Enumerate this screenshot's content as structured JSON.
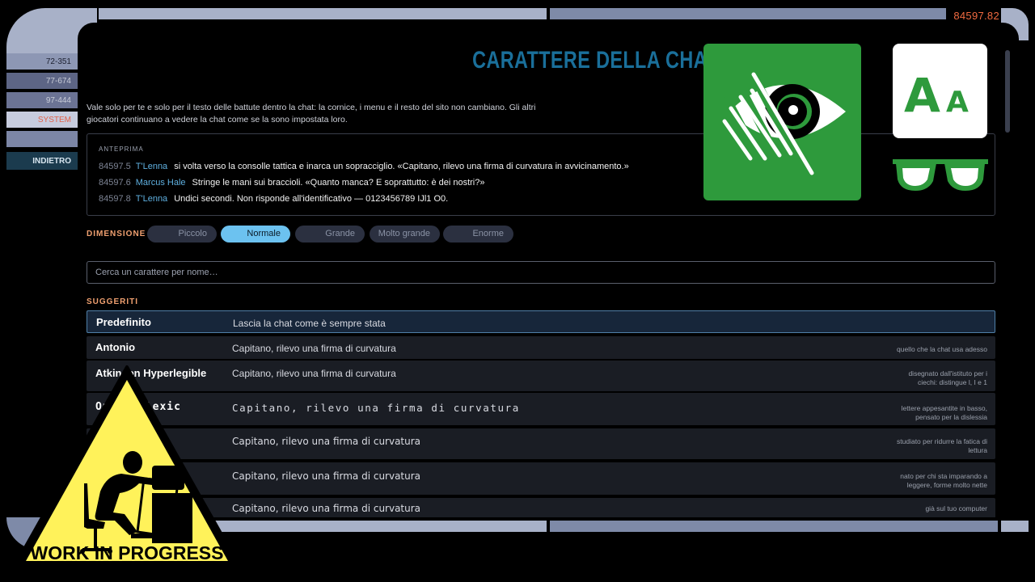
{
  "frame": {
    "stardate": "84597.82",
    "rail": [
      {
        "label": "72-351"
      },
      {
        "label": "77-674"
      },
      {
        "label": "97-444"
      },
      {
        "label": "SYSTEM"
      }
    ],
    "back_label": "INDIETRO"
  },
  "page": {
    "title": "CARATTERE DELLA CHAT",
    "description": "Vale solo per te e solo per il testo delle battute dentro la chat: la cornice, i menu e il resto del sito non cambiano. Gli altri giocatori continuano a vedere la chat come se la sono impostata loro."
  },
  "preview": {
    "label": "ANTEPRIMA",
    "lines": [
      {
        "stardate": "84597.5",
        "who": "T'Lenna",
        "msg": "si volta verso la consolle tattica e inarca un sopracciglio. «Capitano, rilevo una firma di curvatura in avvicinamento.»"
      },
      {
        "stardate": "84597.6",
        "who": "Marcus Hale",
        "msg": "Stringe le mani sui braccioli. «Quanto manca? E soprattutto: è dei nostri?»"
      },
      {
        "stardate": "84597.8",
        "who": "T'Lenna",
        "msg": "Undici secondi. Non risponde all'identificativo — 0123456789 IJl1 O0."
      }
    ]
  },
  "size": {
    "label": "DIMENSIONE",
    "options": [
      "Piccolo",
      "Normale",
      "Grande",
      "Molto grande",
      "Enorme"
    ],
    "selected": "Normale"
  },
  "search": {
    "placeholder": "Cerca un carattere per nome…"
  },
  "suggestions": {
    "label": "SUGGERITI",
    "items": [
      {
        "name": "Predefinito",
        "sample": "Lascia la chat come è sempre stata",
        "note": ""
      },
      {
        "name": "Antonio",
        "sample": "Capitano, rilevo una firma di curvatura",
        "note": "quello che la chat usa adesso"
      },
      {
        "name": "Atkinson Hyperlegible",
        "sample": "Capitano, rilevo una firma di curvatura",
        "note": "disegnato dall'istituto per i ciechi: distingue l, I e 1"
      },
      {
        "name": "OpenDyslexic",
        "sample": "Capitano, rilevo una firma di curvatura",
        "note": "lettere appesantite in basso, pensato per la dislessia"
      },
      {
        "name": "",
        "sample": "Capitano, rilevo una firma di curvatura",
        "note": "studiato per ridurre la fatica di lettura"
      },
      {
        "name": "",
        "sample": "Capitano, rilevo una firma di curvatura",
        "note": "nato per chi sta imparando a leggere, forme molto nette"
      },
      {
        "name": "",
        "sample": "Capitano, rilevo una firma di curvatura",
        "note": "già sul tuo computer"
      }
    ]
  },
  "overlay": {
    "aa_text": "AA",
    "wip_text": "WORK IN PROGRESS",
    "colors": {
      "green": "#2e9a3c",
      "wip_yellow": "#fff25a"
    }
  }
}
